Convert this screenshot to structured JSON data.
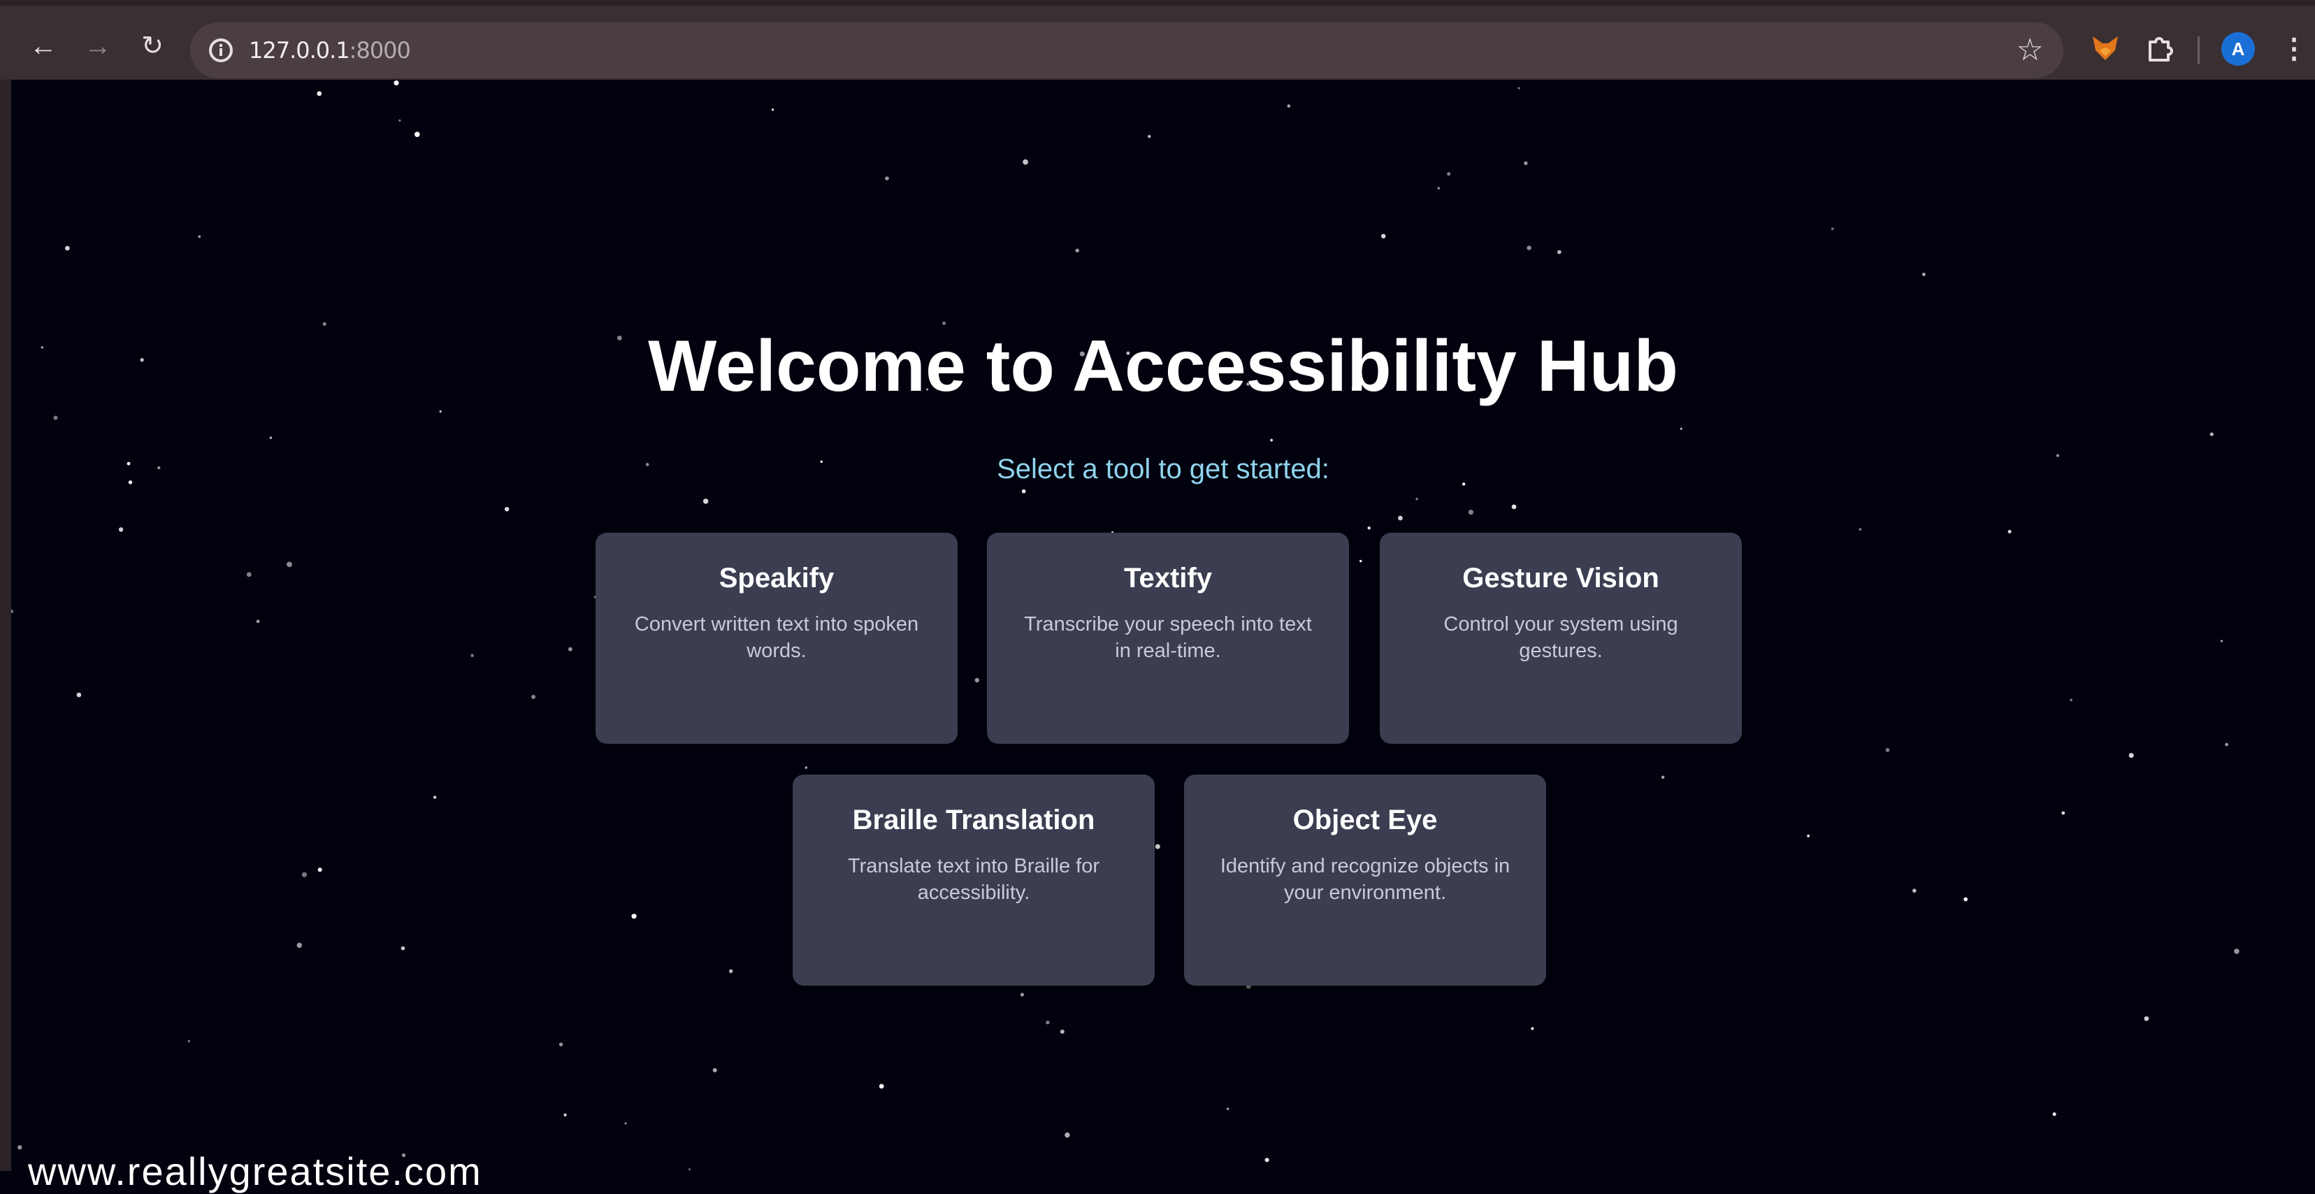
{
  "browser": {
    "url_host": "127.0.0.1",
    "url_port": ":8000",
    "profile_initial": "A",
    "colors": {
      "toolbar": "#3a2f33",
      "omnibox": "#4a3e43",
      "avatar": "#1a6fd6"
    }
  },
  "page": {
    "title": "Welcome to Accessibility Hub",
    "subtitle": "Select a tool to get started:",
    "colors": {
      "background": "#02020f",
      "card": "#3b3d50",
      "subtitle": "#8fd3ec"
    }
  },
  "tools": [
    {
      "name": "Speakify",
      "description": "Convert written text into spoken words."
    },
    {
      "name": "Textify",
      "description": "Transcribe your speech into text in real-time."
    },
    {
      "name": "Gesture Vision",
      "description": "Control your system using gestures."
    },
    {
      "name": "Braille Translation",
      "description": "Translate text into Braille for accessibility."
    },
    {
      "name": "Object Eye",
      "description": "Identify and recognize objects in your environment."
    }
  ],
  "watermark": "www.reallygreatsite.com",
  "icons": {
    "back": "arrow-left-icon",
    "forward": "arrow-right-icon",
    "reload": "reload-icon",
    "site_info": "info-icon",
    "bookmark": "star-icon",
    "extension_fox": "fox-extension-icon",
    "extensions": "puzzle-icon",
    "menu": "kebab-menu-icon"
  }
}
